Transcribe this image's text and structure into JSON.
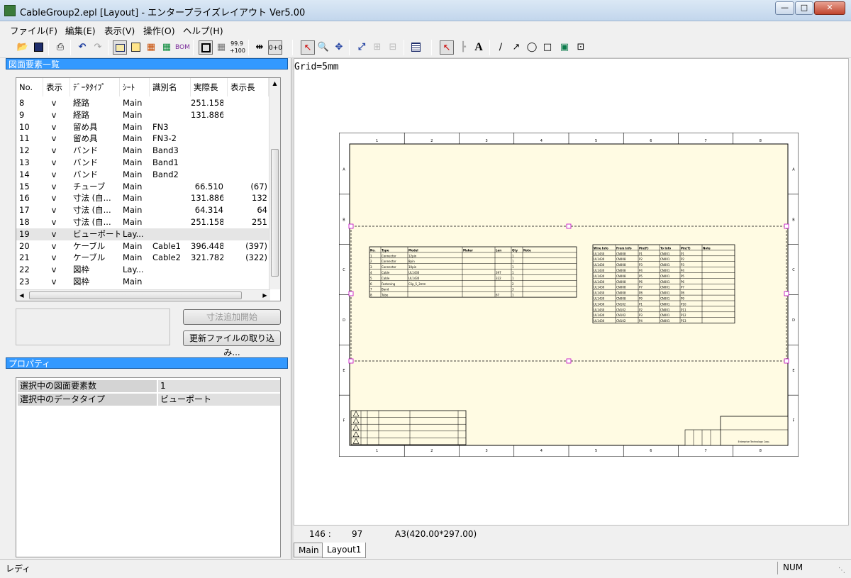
{
  "window": {
    "title": "CableGroup2.epl [Layout] - エンタープライズレイアウト Ver5.00"
  },
  "menu": [
    "ファイル(F)",
    "編集(E)",
    "表示(V)",
    "操作(O)",
    "ヘルプ(H)"
  ],
  "panels": {
    "element_list_title": "図面要素一覧",
    "properties_title": "プロパティ"
  },
  "element_table": {
    "headers": [
      "No.",
      "表示",
      "ﾃﾞｰﾀﾀｲﾌﾟ",
      "ｼｰﾄ",
      "識別名",
      "実際長",
      "表示長"
    ],
    "rows": [
      [
        "8",
        "v",
        "経路",
        "Main",
        "",
        "251.158",
        ""
      ],
      [
        "9",
        "v",
        "経路",
        "Main",
        "",
        "131.886",
        ""
      ],
      [
        "10",
        "v",
        "留め具",
        "Main",
        "FN3",
        "",
        ""
      ],
      [
        "11",
        "v",
        "留め具",
        "Main",
        "FN3-2",
        "",
        ""
      ],
      [
        "12",
        "v",
        "バンド",
        "Main",
        "Band3",
        "",
        ""
      ],
      [
        "13",
        "v",
        "バンド",
        "Main",
        "Band1",
        "",
        ""
      ],
      [
        "14",
        "v",
        "バンド",
        "Main",
        "Band2",
        "",
        ""
      ],
      [
        "15",
        "v",
        "チューブ",
        "Main",
        "",
        "66.510",
        "(67)"
      ],
      [
        "16",
        "v",
        "寸法 (自...",
        "Main",
        "",
        "131.886",
        "132"
      ],
      [
        "17",
        "v",
        "寸法 (自...",
        "Main",
        "",
        "64.314",
        "64"
      ],
      [
        "18",
        "v",
        "寸法 (自...",
        "Main",
        "",
        "251.158",
        "251"
      ],
      [
        "19",
        "v",
        "ビューポート",
        "Lay...",
        "",
        "",
        ""
      ],
      [
        "20",
        "v",
        "ケーブル",
        "Main",
        "Cable1",
        "396.448",
        "(397)"
      ],
      [
        "21",
        "v",
        "ケーブル",
        "Main",
        "Cable2",
        "321.782",
        "(322)"
      ],
      [
        "22",
        "v",
        "図枠",
        "Lay...",
        "",
        "",
        ""
      ],
      [
        "23",
        "v",
        "図枠",
        "Main",
        "",
        "",
        ""
      ]
    ],
    "selected_row": 11
  },
  "buttons": {
    "add_dimension": "寸法追加開始",
    "import_update": "更新ファイルの取り込み..."
  },
  "properties": [
    {
      "label": "選択中の図面要素数",
      "value": "1"
    },
    {
      "label": "選択中のデータタイプ",
      "value": "ビューポート"
    }
  ],
  "canvas": {
    "grid_label": "Grid=5mm",
    "coord_x": "146 :",
    "coord_y": "97",
    "paper": "A3(420.00*297.00)"
  },
  "drawing": {
    "col_numbers": [
      "1",
      "2",
      "3",
      "4",
      "5",
      "6",
      "7",
      "8"
    ],
    "row_letters": [
      "A",
      "B",
      "C",
      "D",
      "E",
      "F"
    ],
    "bom_headers": [
      "No.",
      "Type",
      "Model",
      "Maker",
      "Len",
      "Qty",
      "Note"
    ],
    "bom_rows": [
      [
        "1",
        "Connector",
        "12pin",
        "",
        "",
        "1",
        ""
      ],
      [
        "2",
        "Connector",
        "8pin",
        "",
        "",
        "1",
        ""
      ],
      [
        "3",
        "Connector",
        "10pin",
        "",
        "",
        "1",
        ""
      ],
      [
        "4",
        "Cable",
        "UL1430",
        "",
        "397",
        "1",
        ""
      ],
      [
        "5",
        "Cable",
        "UL1430",
        "",
        "322",
        "1",
        ""
      ],
      [
        "6",
        "Fastening",
        "Clip_5_3mm",
        "",
        "",
        "2",
        ""
      ],
      [
        "7",
        "Band",
        "",
        "",
        "",
        "3",
        ""
      ],
      [
        "8",
        "Tube",
        "",
        "",
        "67",
        "1",
        ""
      ]
    ],
    "wire_headers": [
      "Wire Info",
      "From Info",
      "Pin(F)",
      "To Info",
      "Pin(T)",
      "Note"
    ],
    "wire_rows": [
      [
        "UL1430",
        "CN008",
        "P1",
        "CN001",
        "P1",
        ""
      ],
      [
        "UL1430",
        "CN008",
        "P2",
        "CN001",
        "P2",
        ""
      ],
      [
        "UL1430",
        "CN008",
        "P3",
        "CN001",
        "P3",
        ""
      ],
      [
        "UL1430",
        "CN008",
        "P4",
        "CN001",
        "P4",
        ""
      ],
      [
        "UL1430",
        "CN008",
        "P5",
        "CN001",
        "P5",
        ""
      ],
      [
        "UL1430",
        "CN008",
        "P6",
        "CN001",
        "P6",
        ""
      ],
      [
        "UL1430",
        "CN008",
        "P7",
        "CN001",
        "P7",
        ""
      ],
      [
        "UL1430",
        "CN008",
        "P8",
        "CN001",
        "P8",
        ""
      ],
      [
        "UL1430",
        "CN008",
        "P9",
        "CN001",
        "P9",
        ""
      ],
      [
        "UL1430",
        "CN102",
        "P1",
        "CN001",
        "P10",
        ""
      ],
      [
        "UL1430",
        "CN102",
        "P2",
        "CN001",
        "P11",
        ""
      ],
      [
        "UL1430",
        "CN102",
        "P3",
        "CN001",
        "P12",
        ""
      ],
      [
        "UL1430",
        "CN102",
        "P4",
        "CN001",
        "P13",
        ""
      ]
    ],
    "title_block_footer": "Enterprise Technology Corp."
  },
  "sheet_tabs": [
    "Main",
    "Layout1"
  ],
  "status": {
    "left": "レディ",
    "num": "NUM"
  }
}
